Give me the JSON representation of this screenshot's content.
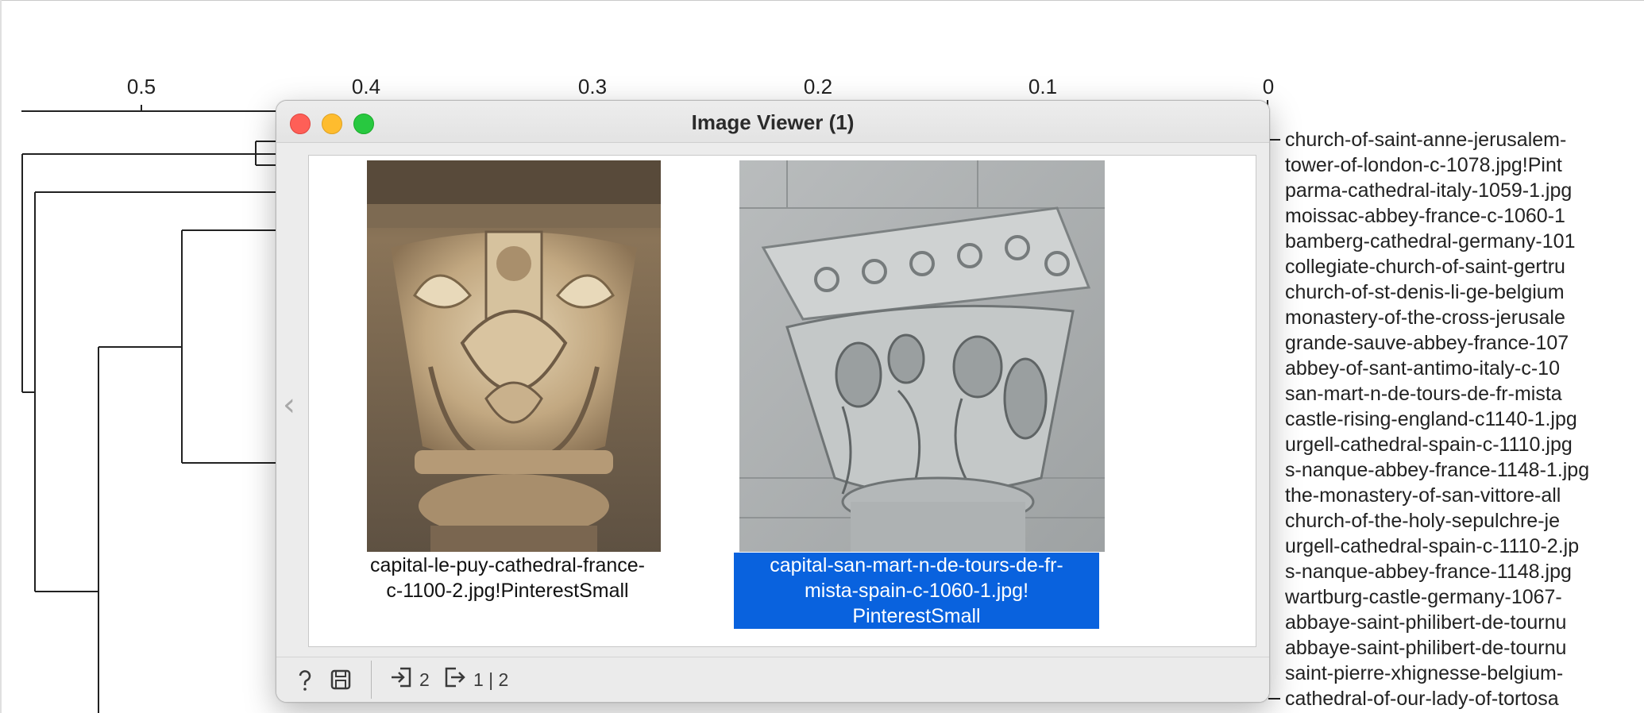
{
  "dendrogram": {
    "scale_ticks": [
      {
        "label": "0.5",
        "value": 0.5
      },
      {
        "label": "0.4",
        "value": 0.4
      },
      {
        "label": "0.3",
        "value": 0.3
      },
      {
        "label": "0.2",
        "value": 0.2
      },
      {
        "label": "0.1",
        "value": 0.1
      },
      {
        "label": "0",
        "value": 0
      }
    ],
    "leaves": [
      "church-of-saint-anne-jerusalem-",
      "tower-of-london-c-1078.jpg!Pint",
      "parma-cathedral-italy-1059-1.jpg",
      "moissac-abbey-france-c-1060-1",
      "bamberg-cathedral-germany-101",
      "collegiate-church-of-saint-gertru",
      "church-of-st-denis-li-ge-belgium",
      "monastery-of-the-cross-jerusale",
      "grande-sauve-abbey-france-107",
      "abbey-of-sant-antimo-italy-c-10",
      "san-mart-n-de-tours-de-fr-mista",
      "castle-rising-england-c1140-1.jpg",
      "urgell-cathedral-spain-c-1110.jpg",
      "s-nanque-abbey-france-1148-1.jpg",
      "the-monastery-of-san-vittore-all",
      "church-of-the-holy-sepulchre-je",
      "urgell-cathedral-spain-c-1110-2.jp",
      "s-nanque-abbey-france-1148.jpg",
      "wartburg-castle-germany-1067-",
      "abbaye-saint-philibert-de-tournu",
      "abbaye-saint-philibert-de-tournu",
      "saint-pierre-xhignesse-belgium-",
      "cathedral-of-our-lady-of-tortosa"
    ]
  },
  "viewer": {
    "title": "Image Viewer (1)",
    "images": [
      {
        "caption": "capital-le-puy-cathedral-france-\nc-1100-2.jpg!PinterestSmall",
        "selected": false
      },
      {
        "caption": "capital-san-mart-n-de-tours-de-fr-\nmista-spain-c-1060-1.jpg!\nPinterestSmall",
        "selected": true
      }
    ],
    "toolbar": {
      "input_count": "2",
      "output_count": "1 | 2"
    }
  },
  "colors": {
    "selection": "#0962de",
    "close": "#fe5f57",
    "minimize": "#febc2e",
    "maximize": "#28c840"
  },
  "icons": [
    "help-icon",
    "save-icon",
    "input-icon",
    "output-icon",
    "chevron-left-icon"
  ]
}
